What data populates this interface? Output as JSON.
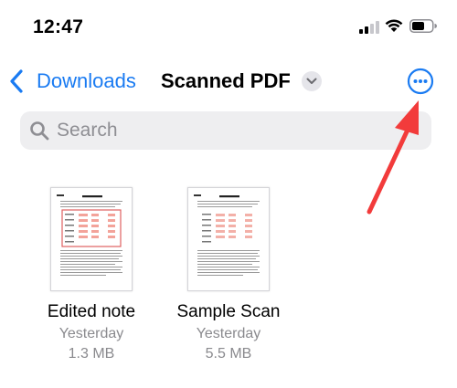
{
  "status_bar": {
    "time": "12:47"
  },
  "nav": {
    "back_label": "Downloads",
    "title": "Scanned PDF",
    "accent": "#1A7BF2"
  },
  "search": {
    "placeholder": "Search"
  },
  "files": [
    {
      "name": "Edited note",
      "date": "Yesterday",
      "size": "1.3 MB",
      "highlighted": true
    },
    {
      "name": "Sample Scan",
      "date": "Yesterday",
      "size": "5.5 MB",
      "highlighted": false
    }
  ],
  "annotation": {
    "arrow_color": "#F23B3B"
  }
}
